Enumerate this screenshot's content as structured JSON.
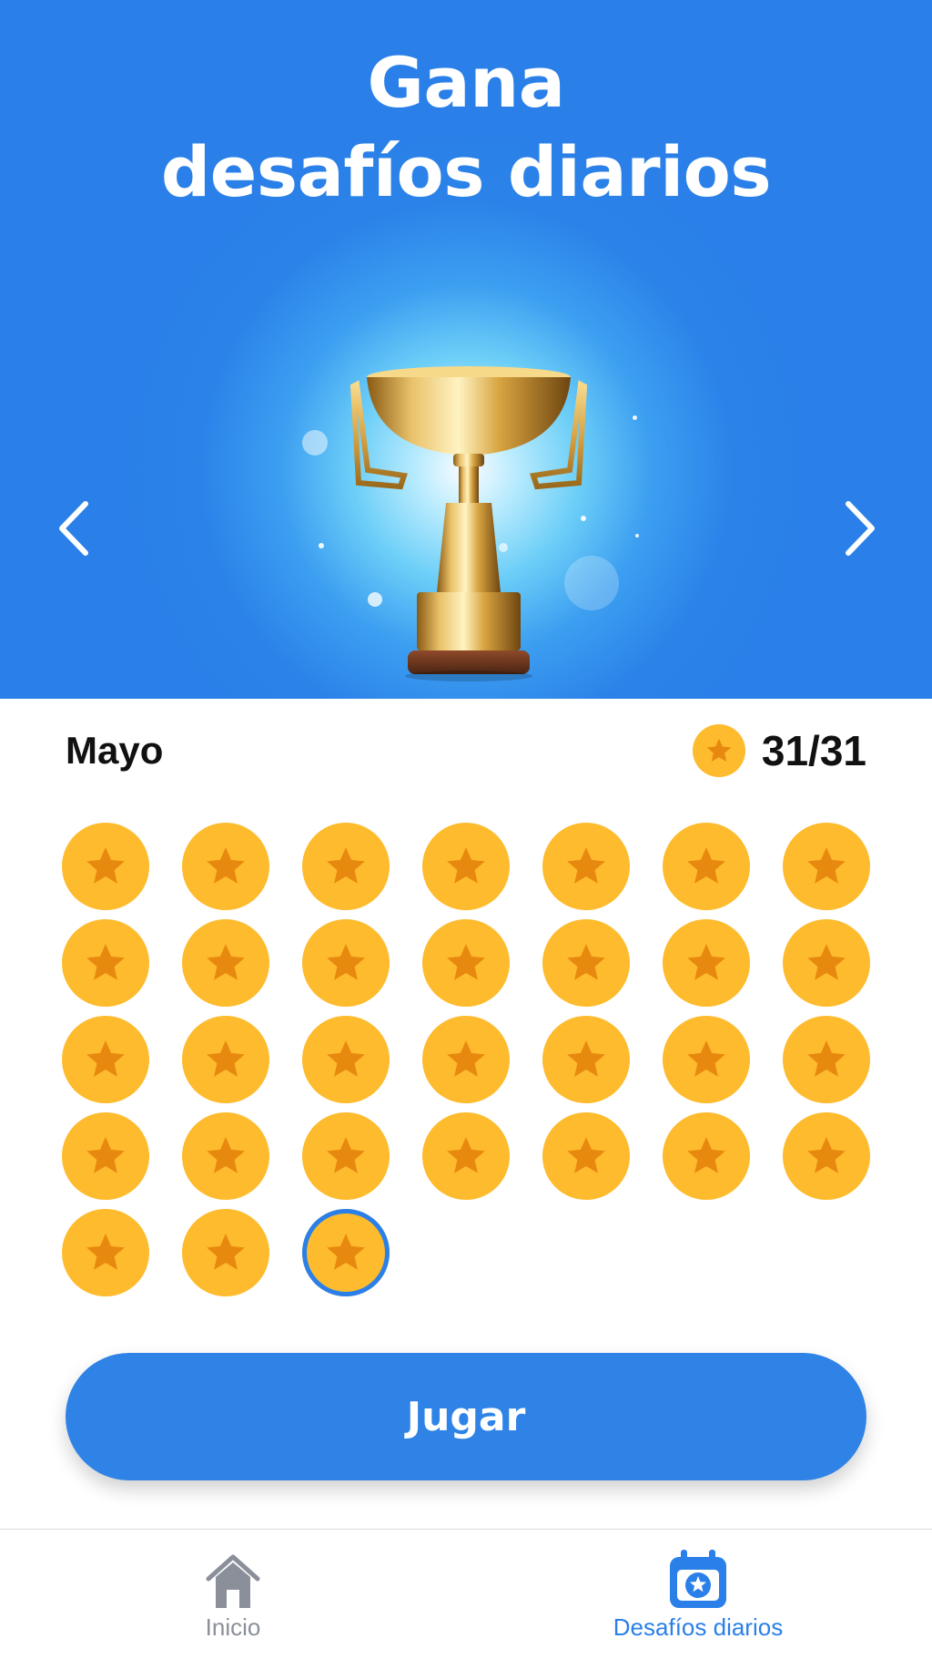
{
  "hero": {
    "title_line1": "Gana",
    "title_line2": "desafíos diarios",
    "background_color": "#2a80e8",
    "prev_icon": "chevron-left-icon",
    "next_icon": "chevron-right-icon",
    "image": "trophy"
  },
  "month": {
    "label": "Mayo",
    "score": "31/31",
    "coin_icon": "star-coin-icon"
  },
  "calendar": {
    "days_completed": [
      1,
      2,
      3,
      4,
      5,
      6,
      7,
      8,
      9,
      10,
      11,
      12,
      13,
      14,
      15,
      16,
      17,
      18,
      19,
      20,
      21,
      22,
      23,
      24,
      25,
      26,
      27,
      28,
      29,
      30,
      31
    ],
    "selected_day": 31,
    "coin_color": "#fdbb2d",
    "star_color": "#e8890f",
    "selection_color": "#2a80e8"
  },
  "play_button": {
    "label": "Jugar",
    "color": "#2f83e6"
  },
  "tabbar": {
    "tabs": [
      {
        "label": "Inicio",
        "icon": "home-icon",
        "active": false
      },
      {
        "label": "Desafíos diarios",
        "icon": "calendar-star-icon",
        "active": true
      }
    ]
  }
}
